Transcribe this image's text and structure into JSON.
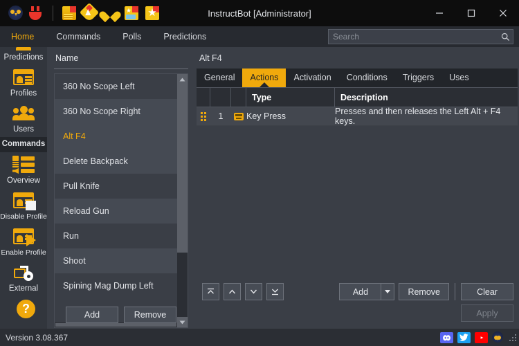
{
  "window": {
    "title": "InstructBot [Administrator]",
    "minimize_label": "minimize",
    "maximize_label": "maximize",
    "close_label": "close",
    "toolbar_icons": [
      {
        "name": "owl-logo-icon",
        "label": "InstructBot"
      },
      {
        "name": "plug-icon",
        "label": "Connection"
      },
      {
        "name": "bits-icon",
        "label": "Bits"
      },
      {
        "name": "subscription-tag-icon",
        "label": "Subscription"
      },
      {
        "name": "follow-heart-icon",
        "label": "Follow"
      },
      {
        "name": "cheer-icon",
        "label": "Cheer"
      },
      {
        "name": "star-icon",
        "label": "Channel Points"
      }
    ]
  },
  "menubar": {
    "items": [
      {
        "label": "Home",
        "active": true
      },
      {
        "label": "Commands",
        "active": false
      },
      {
        "label": "Polls",
        "active": false
      },
      {
        "label": "Predictions",
        "active": false
      }
    ]
  },
  "search": {
    "placeholder": "Search",
    "value": "",
    "icon": "search-icon"
  },
  "sidebar": {
    "items": [
      {
        "label": "Predictions",
        "icon": "predictions-card-icon",
        "active": false,
        "partial": true
      },
      {
        "label": "Profiles",
        "icon": "profiles-card-icon",
        "active": false
      },
      {
        "label": "Users",
        "icon": "users-icon",
        "active": false
      },
      {
        "label": "Commands",
        "icon": "commands-icon",
        "active": true
      },
      {
        "label": "Overview",
        "icon": "overview-icon",
        "active": false
      },
      {
        "label": "Disable Profile",
        "icon": "disable-profile-icon",
        "active": false
      },
      {
        "label": "Enable Profile",
        "icon": "enable-profile-icon",
        "active": false
      },
      {
        "label": "External",
        "icon": "external-gear-icon",
        "active": false
      },
      {
        "label": "Help",
        "icon": "help-question-icon",
        "active": false
      }
    ]
  },
  "command_list": {
    "header": "Name",
    "rows": [
      {
        "name": "360 No Scope Left",
        "selected": false
      },
      {
        "name": "360 No Scope Right",
        "selected": false
      },
      {
        "name": "Alt F4",
        "selected": true
      },
      {
        "name": "Delete Backpack",
        "selected": false
      },
      {
        "name": "Pull Knife",
        "selected": false
      },
      {
        "name": "Reload Gun",
        "selected": false
      },
      {
        "name": "Run",
        "selected": false
      },
      {
        "name": "Shoot",
        "selected": false
      },
      {
        "name": "Spining Mag Dump Left",
        "selected": false
      }
    ],
    "add_label": "Add",
    "remove_label": "Remove",
    "scroll_up_icon": "chevron-up-icon",
    "scroll_down_icon": "chevron-down-icon"
  },
  "detail": {
    "title": "Alt F4",
    "tabs": [
      {
        "label": "General",
        "active": false
      },
      {
        "label": "Actions",
        "active": true
      },
      {
        "label": "Activation",
        "active": false
      },
      {
        "label": "Conditions",
        "active": false
      },
      {
        "label": "Triggers",
        "active": false
      },
      {
        "label": "Uses",
        "active": false
      }
    ],
    "table": {
      "columns": [
        "",
        "",
        "",
        "Type",
        "Description"
      ],
      "rows": [
        {
          "handle": "drag-handle-icon",
          "index": "1",
          "icon": "key-press-icon",
          "type": "Key Press",
          "description": "Presses and then releases the Left Alt + F4 keys."
        }
      ]
    },
    "nav_buttons": [
      {
        "name": "move-to-top-button",
        "icon": "double-chevron-up-icon"
      },
      {
        "name": "move-up-button",
        "icon": "chevron-up-icon"
      },
      {
        "name": "move-down-button",
        "icon": "chevron-down-icon"
      },
      {
        "name": "move-to-bottom-button",
        "icon": "double-chevron-down-icon"
      }
    ],
    "add_label": "Add",
    "add_dropdown_icon": "caret-down-icon",
    "remove_label": "Remove",
    "clear_label": "Clear",
    "apply_label": "Apply",
    "apply_enabled": false
  },
  "statusbar": {
    "version": "Version 3.08.367",
    "social": [
      {
        "name": "discord-icon",
        "label": "Discord",
        "color": "#5865f2"
      },
      {
        "name": "twitter-icon",
        "label": "Twitter",
        "color": "#1da1f2"
      },
      {
        "name": "youtube-icon",
        "label": "YouTube",
        "color": "#ff0000"
      },
      {
        "name": "owl-logo-icon",
        "label": "InstructBot"
      }
    ],
    "resize_grip": "resize-grip-icon"
  },
  "colors": {
    "accent": "#f0a90c",
    "window_bg": "#3a3e46",
    "titlebar_bg": "#0d0d0d",
    "menubar_bg": "#272a30",
    "sidebar_bg": "#32363d",
    "tabstrip_bg": "#22252a"
  }
}
